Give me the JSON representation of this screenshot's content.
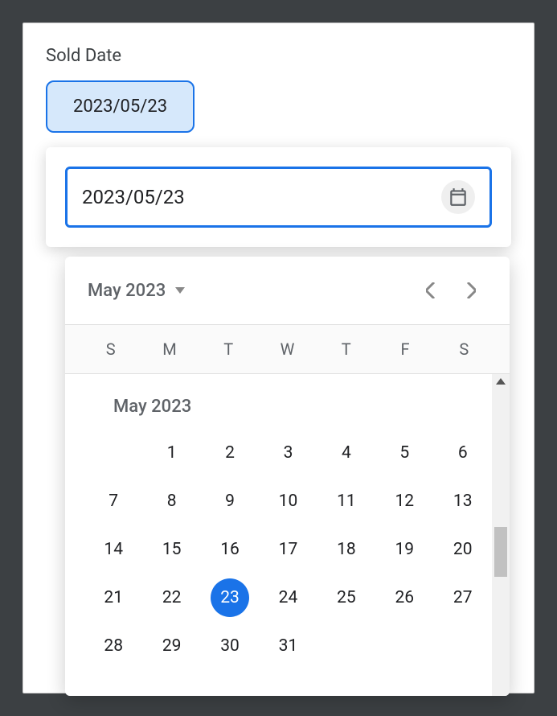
{
  "field": {
    "label": "Sold Date",
    "display_value": "2023/05/23",
    "input_value": "2023/05/23"
  },
  "calendar": {
    "header_month": "May 2023",
    "body_month_label": "May 2023",
    "dow": [
      "S",
      "M",
      "T",
      "W",
      "T",
      "F",
      "S"
    ],
    "selected_day": 23,
    "weeks": [
      [
        "",
        "1",
        "2",
        "3",
        "4",
        "5",
        "6"
      ],
      [
        "7",
        "8",
        "9",
        "10",
        "11",
        "12",
        "13"
      ],
      [
        "14",
        "15",
        "16",
        "17",
        "18",
        "19",
        "20"
      ],
      [
        "21",
        "22",
        "23",
        "24",
        "25",
        "26",
        "27"
      ],
      [
        "28",
        "29",
        "30",
        "31",
        "",
        "",
        ""
      ]
    ]
  }
}
